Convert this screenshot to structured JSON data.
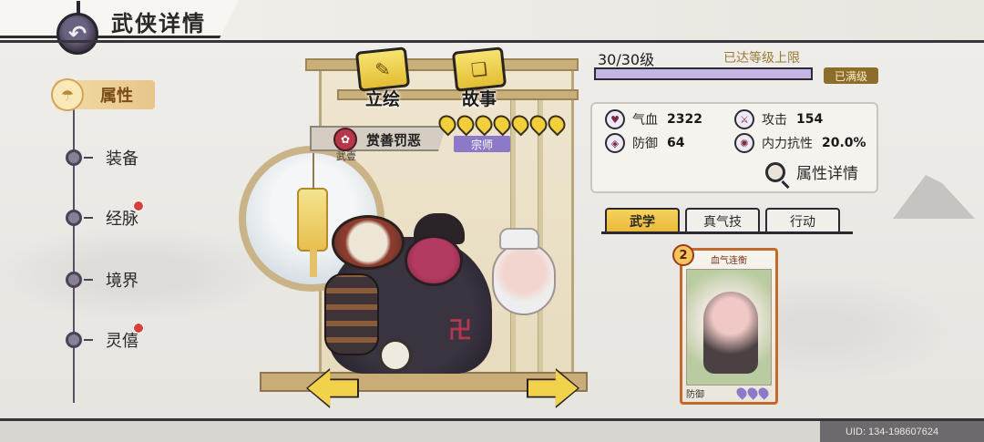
{
  "header": {
    "title": "武侠详情"
  },
  "nav": {
    "items": [
      {
        "label": "属性",
        "active": true,
        "alert": false
      },
      {
        "label": "装备",
        "active": false,
        "alert": false
      },
      {
        "label": "经脉",
        "active": false,
        "alert": true
      },
      {
        "label": "境界",
        "active": false,
        "alert": false
      },
      {
        "label": "灵僖",
        "active": false,
        "alert": true
      }
    ]
  },
  "character": {
    "title": "赏善罚恶",
    "sub": "武壹",
    "rank": "宗师",
    "stars": 7
  },
  "buttons": {
    "portrait": "立绘",
    "story": "故事"
  },
  "level": {
    "text": "30/30级",
    "max_text": "已达等级上限",
    "badge": "已满级",
    "progress": 1.0
  },
  "stats": {
    "hp_label": "气血",
    "hp_value": "2322",
    "atk_label": "攻击",
    "atk_value": "154",
    "def_label": "防御",
    "def_value": "64",
    "res_label": "内力抗性",
    "res_value": "20.0%",
    "detail_label": "属性详情"
  },
  "tabs": [
    "武学",
    "真气技",
    "行动"
  ],
  "skill_card": {
    "name": "血气连衡",
    "cost": "2",
    "type": "防御",
    "pips": 3
  },
  "footer": {
    "uid": "UID: 134-198607624"
  },
  "colors": {
    "accent": "#f2d24a",
    "rank": "#8c7ac9",
    "alert": "#d8403a"
  }
}
